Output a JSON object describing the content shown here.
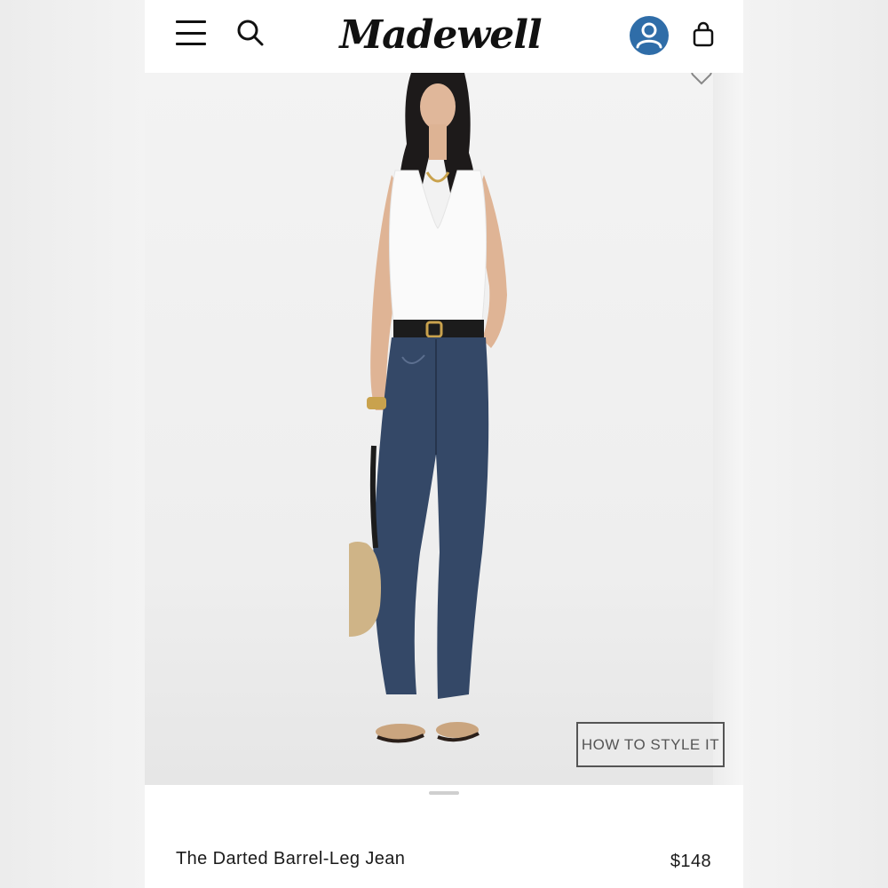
{
  "header": {
    "brand": "Madewell"
  },
  "hero": {
    "style_button_label": "HOW TO STYLE IT"
  },
  "product": {
    "name": "The Darted Barrel-Leg Jean",
    "price": "$148"
  },
  "colors": {
    "account_accent": "#2f6da8",
    "denim": "#344867",
    "text": "#1a1a1a"
  },
  "icons": [
    "menu-icon",
    "search-icon",
    "account-icon",
    "bag-icon",
    "heart-icon"
  ]
}
